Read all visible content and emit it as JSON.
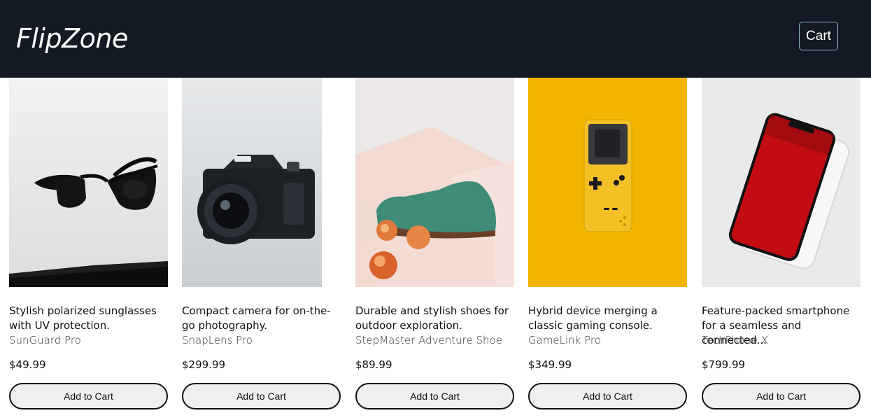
{
  "header": {
    "brand": "FlipZone",
    "cart_label": "Cart"
  },
  "products": [
    {
      "description": "Stylish polarized sunglasses with UV protection.",
      "name": "SunGuard Pro",
      "price": "$49.99",
      "button": "Add to Cart",
      "image": "sunglasses-image",
      "bg": "#e9eaea"
    },
    {
      "description": "Compact camera for on-the-go photography.",
      "name": "SnapLens Pro",
      "price": "$299.99",
      "button": "Add to Cart",
      "image": "camera-image",
      "bg": "#d9dcde"
    },
    {
      "description": "Durable and stylish shoes for outdoor exploration.",
      "name": "StepMaster Adventure Shoe",
      "price": "$89.99",
      "button": "Add to Cart",
      "image": "shoe-image",
      "bg": "#ece6e4"
    },
    {
      "description": "Hybrid device merging a classic gaming console.",
      "name": "GameLink Pro",
      "price": "$349.99",
      "button": "Add to Cart",
      "image": "handheld-console-image",
      "bg": "#f2b400"
    },
    {
      "description": "Feature-packed smartphone for a seamless and connected...",
      "name": "TechPhone X",
      "price": "$799.99",
      "button": "Add to Cart",
      "image": "smartphone-image",
      "bg": "#e7e8e8"
    }
  ]
}
